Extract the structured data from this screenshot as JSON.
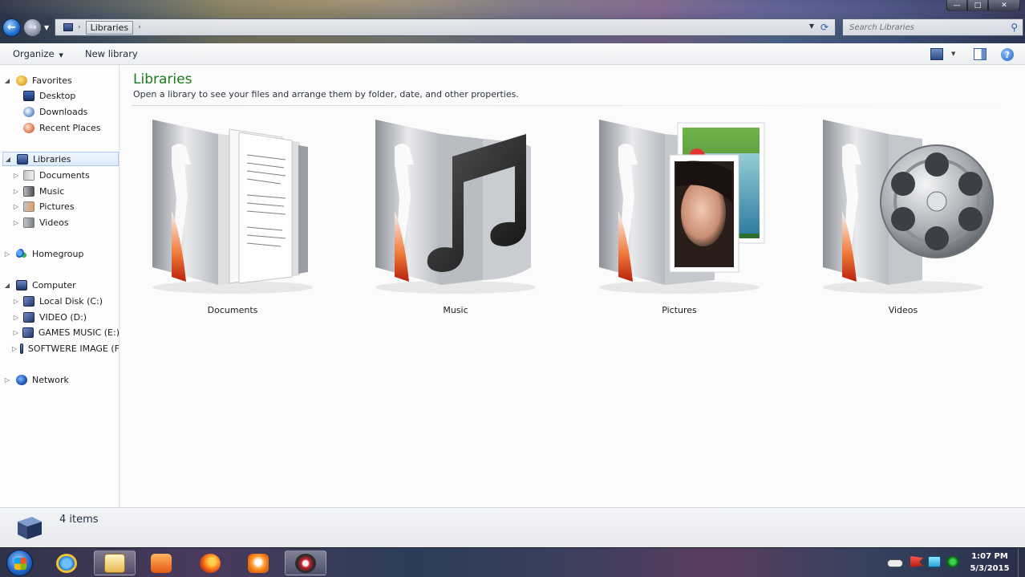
{
  "window": {
    "address": {
      "crumbs": [
        "Libraries"
      ],
      "separator": "›"
    },
    "search": {
      "placeholder": "Search Libraries"
    },
    "controls": {
      "minimize": "—",
      "maximize": "□",
      "close": "✕"
    }
  },
  "command_bar": {
    "organize_label": "Organize",
    "new_library_label": "New library",
    "help_label": "?"
  },
  "nav_pane": {
    "sections": [
      {
        "id": "favorites",
        "label": "Favorites",
        "icon": "star-icon",
        "expanded": true,
        "items": [
          {
            "label": "Desktop",
            "icon": "desktop-icon"
          },
          {
            "label": "Downloads",
            "icon": "downloads-icon"
          },
          {
            "label": "Recent Places",
            "icon": "recent-places-icon"
          }
        ]
      },
      {
        "id": "libraries",
        "label": "Libraries",
        "icon": "libraries-icon",
        "expanded": true,
        "selected": true,
        "items": [
          {
            "label": "Documents",
            "icon": "documents-library-icon"
          },
          {
            "label": "Music",
            "icon": "music-library-icon"
          },
          {
            "label": "Pictures",
            "icon": "pictures-library-icon"
          },
          {
            "label": "Videos",
            "icon": "videos-library-icon"
          }
        ]
      },
      {
        "id": "homegroup",
        "label": "Homegroup",
        "icon": "homegroup-icon",
        "expanded": false,
        "items": []
      },
      {
        "id": "computer",
        "label": "Computer",
        "icon": "computer-icon",
        "expanded": true,
        "items": [
          {
            "label": "Local Disk (C:)",
            "icon": "drive-icon"
          },
          {
            "label": "VIDEO (D:)",
            "icon": "drive-icon"
          },
          {
            "label": "GAMES MUSIC (E:)",
            "icon": "drive-icon"
          },
          {
            "label": "SOFTWERE IMAGE (F",
            "icon": "drive-icon"
          }
        ]
      },
      {
        "id": "network",
        "label": "Network",
        "icon": "network-icon",
        "expanded": false,
        "items": []
      }
    ]
  },
  "content": {
    "title": "Libraries",
    "subtitle": "Open a library to see your files and arrange them by folder, date, and other properties.",
    "libraries": [
      {
        "label": "Documents",
        "icon": "documents-library-icon"
      },
      {
        "label": "Music",
        "icon": "music-library-icon"
      },
      {
        "label": "Pictures",
        "icon": "pictures-library-icon"
      },
      {
        "label": "Videos",
        "icon": "videos-library-icon"
      }
    ]
  },
  "details": {
    "count_text": "4 items"
  },
  "taskbar": {
    "apps": [
      {
        "name": "internet-explorer-icon"
      },
      {
        "name": "windows-explorer-icon",
        "active": true
      },
      {
        "name": "media-player-icon"
      },
      {
        "name": "firefox-icon"
      },
      {
        "name": "uc-browser-icon"
      },
      {
        "name": "app-icon"
      }
    ],
    "clock": {
      "time": "1:07 PM",
      "date": "5/3/2015"
    }
  },
  "colors": {
    "title_green": "#1e7a1e",
    "selection": "#dcebfb"
  }
}
